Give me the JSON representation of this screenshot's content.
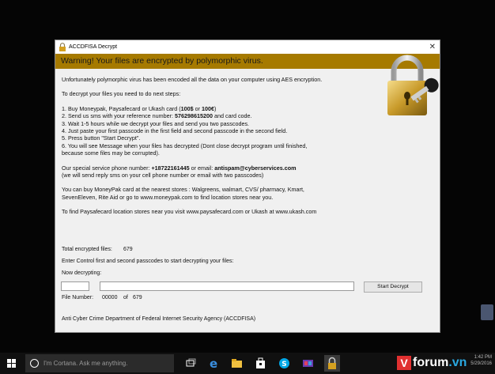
{
  "window": {
    "title": "ACCDFISA Decrypt",
    "close_glyph": "✕",
    "banner": "Warning! Your files are encrypted by polymorphic virus."
  },
  "message": {
    "intro": "Unfortunately polymorphic virus has been encoded all the data on your computer using AES encryption.",
    "steps_intro": "To decrypt your files you need to do next steps:",
    "step1_a": "1. Buy Moneypak, Paysafecard or Ukash card (",
    "step1_b1": "100$",
    "step1_or": " or ",
    "step1_b2": "100€",
    "step1_c": ")",
    "step2_a": "2. Send us sms with your reference number: ",
    "step2_ref": "576298615200",
    "step2_b": " and card code.",
    "step3": "3. Wait 1-5 hours while we decrypt your files and send you two passcodes.",
    "step4": "4. Just paste your first passcode in the first field and second passcode in the second field.",
    "step5": "5. Press button \"Start Decrypt\".",
    "step6a": "6. You will see Message when your files has decrypted (Dont close decrypt program until finished,",
    "step6b": "because some files may be corrupted).",
    "phone_a": "Our special service phone number: ",
    "phone_num": "+18722161445",
    "phone_b": " or email: ",
    "email": "antispam@cyberservices.com",
    "phone_note": "(we will send reply sms on your cell phone number or email with two passcodes)",
    "moneypak_a": "You can buy MoneyPak card at the nearest stores : Walgreens, walmart, CVS/ pharmacy, Kmart,",
    "moneypak_b": "SevenEleven, Rite Aid  or go to www.moneypak.com to find location stores near you.",
    "paysafe": "To find Paysafecard location stores near you visit www.paysafecard.com or Ukash at www.ukash.com"
  },
  "form": {
    "total_label": "Total encrypted files:",
    "total_value": "679",
    "enter_label": "Enter Control first and second passcodes to start decrypting your files:",
    "now_label": "Now decrypting:",
    "passcode1": "",
    "passcode2": "",
    "start_button": "Start Decrypt",
    "file_number_label": "File Number:",
    "file_number_value": "00000",
    "of_label": "of",
    "file_total": "679",
    "footer": "Anti Cyber Crime Department of Federal Internet Security Agency (ACCDFISA)"
  },
  "taskbar": {
    "search_placeholder": "I'm Cortana. Ask me anything.",
    "watermark_v": "V",
    "watermark_text": "forum",
    "watermark_tld": ".vn",
    "clock_time": "1:42 PM",
    "clock_date": "5/29/2016"
  },
  "colors": {
    "banner": "#a67a00",
    "taskbar": "#101010"
  }
}
